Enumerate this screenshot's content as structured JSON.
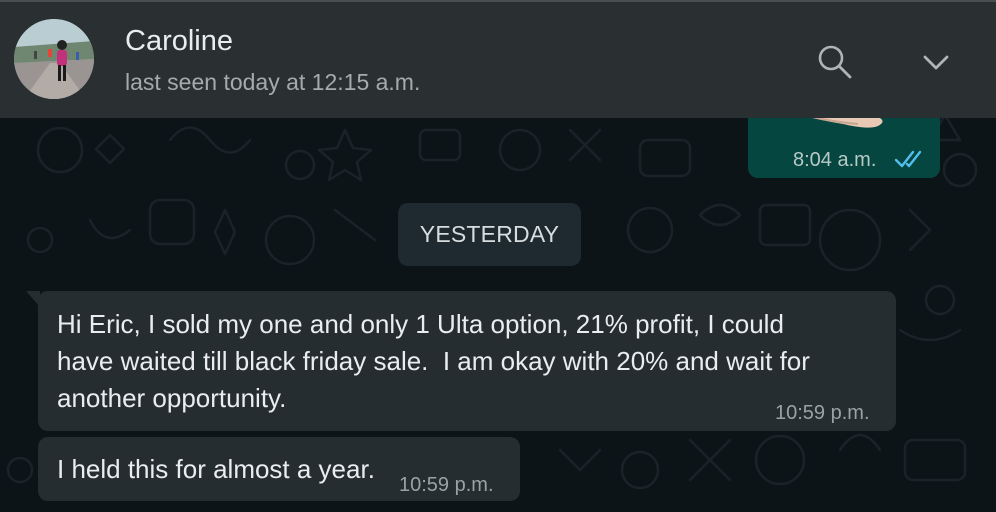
{
  "header": {
    "contact_name": "Caroline",
    "last_seen": "last seen today at 12:15 a.m.",
    "search_icon": "search-icon",
    "menu_icon": "chevron-down-icon"
  },
  "messages": [
    {
      "direction": "outgoing",
      "type": "image",
      "time": "8:04 a.m.",
      "status": "read",
      "status_icon": "double-check-icon"
    },
    {
      "type": "date-separator",
      "label": "YESTERDAY"
    },
    {
      "direction": "incoming",
      "text": "Hi Eric, I sold my one and only 1 Ulta option, 21% profit, I could\nhave waited till black friday sale.  I am okay with 20% and wait for\nanother opportunity.",
      "time": "10:59 p.m."
    },
    {
      "direction": "incoming",
      "text": "I held this for almost a year.",
      "time": "10:59 p.m."
    }
  ],
  "colors": {
    "header_bg": "#2a2f32",
    "chat_bg": "#0d1418",
    "incoming_bubble": "#262d31",
    "outgoing_bubble": "#054740",
    "read_tick": "#53bdeb",
    "primary_text": "#e9edef",
    "secondary_text": "#a5abad"
  }
}
